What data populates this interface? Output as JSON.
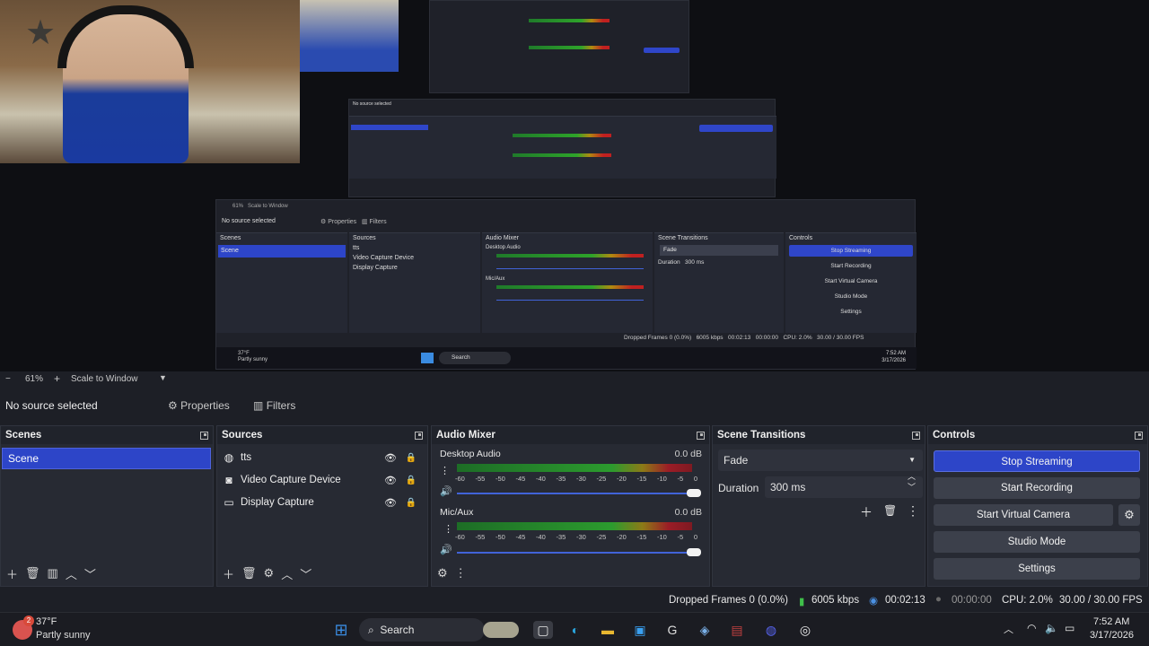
{
  "colors": {
    "accent": "#2d45c8",
    "bg": "#1d1f26",
    "panel": "#272a33",
    "meter_green": "#2c9b2e",
    "meter_yellow": "#8d7a17",
    "meter_red": "#9b1c26"
  },
  "nested_preview": {
    "zoom": "61%",
    "scale": "Scale to Window",
    "no_source": "No source selected",
    "properties": "Properties",
    "filters": "Filters",
    "scenes_title": "Scenes",
    "scene": "Scene",
    "sources_title": "Sources",
    "sources": [
      "tts",
      "Video Capture Device",
      "Display Capture"
    ],
    "mixer_title": "Audio Mixer",
    "desktop_audio": "Desktop Audio",
    "mic_aux": "Mic/Aux",
    "db": "0.0 dB",
    "transitions_title": "Scene Transitions",
    "fade": "Fade",
    "duration_label": "Duration",
    "duration": "300 ms",
    "controls_title": "Controls",
    "controls": [
      "Stop Streaming",
      "Start Recording",
      "Start Virtual Camera",
      "Studio Mode",
      "Settings"
    ],
    "status": {
      "dropped": "Dropped Frames 0 (0.0%)",
      "kbps": "6005 kbps",
      "time": "00:02:13",
      "rec": "00:00:00",
      "cpu": "CPU: 2.0%",
      "fps": "30.00 / 30.00 FPS"
    },
    "weather": {
      "temp": "37°F",
      "desc": "Partly sunny"
    },
    "search": "Search",
    "clock": {
      "time": "7:52 AM",
      "date": "3/17/2026"
    }
  },
  "toolbar": {
    "minus": "−",
    "zoom": "61%",
    "plus": "+",
    "scale": "Scale to Window"
  },
  "source_bar": {
    "no_source": "No source selected",
    "properties": "Properties",
    "filters": "Filters"
  },
  "scenes": {
    "title": "Scenes",
    "items": [
      "Scene"
    ]
  },
  "sources": {
    "title": "Sources",
    "items": [
      {
        "name": "tts",
        "icon": "globe-icon"
      },
      {
        "name": "Video Capture Device",
        "icon": "camera-icon"
      },
      {
        "name": "Display Capture",
        "icon": "monitor-icon"
      }
    ]
  },
  "mixer": {
    "title": "Audio Mixer",
    "channels": [
      {
        "name": "Desktop Audio",
        "db": "0.0 dB",
        "volume": 1.0
      },
      {
        "name": "Mic/Aux",
        "db": "0.0 dB",
        "volume": 1.0
      }
    ],
    "ticks": [
      "-60",
      "-55",
      "-50",
      "-45",
      "-40",
      "-35",
      "-30",
      "-25",
      "-20",
      "-15",
      "-10",
      "-5",
      "0"
    ]
  },
  "transitions": {
    "title": "Scene Transitions",
    "selected": "Fade",
    "duration_label": "Duration",
    "duration": "300 ms"
  },
  "controls": {
    "title": "Controls",
    "stop_streaming": "Stop Streaming",
    "start_recording": "Start Recording",
    "start_virtual_camera": "Start Virtual Camera",
    "studio_mode": "Studio Mode",
    "settings": "Settings"
  },
  "status": {
    "dropped": "Dropped Frames 0 (0.0%)",
    "kbps": "6005 kbps",
    "stream_time": "00:02:13",
    "rec_time": "00:00:00",
    "cpu": "CPU: 2.0%",
    "fps": "30.00 / 30.00 FPS"
  },
  "taskbar": {
    "temp": "37°F",
    "weather": "Partly sunny",
    "badge": "2",
    "search": "Search",
    "time": "7:52 AM",
    "date": "3/17/2026"
  }
}
